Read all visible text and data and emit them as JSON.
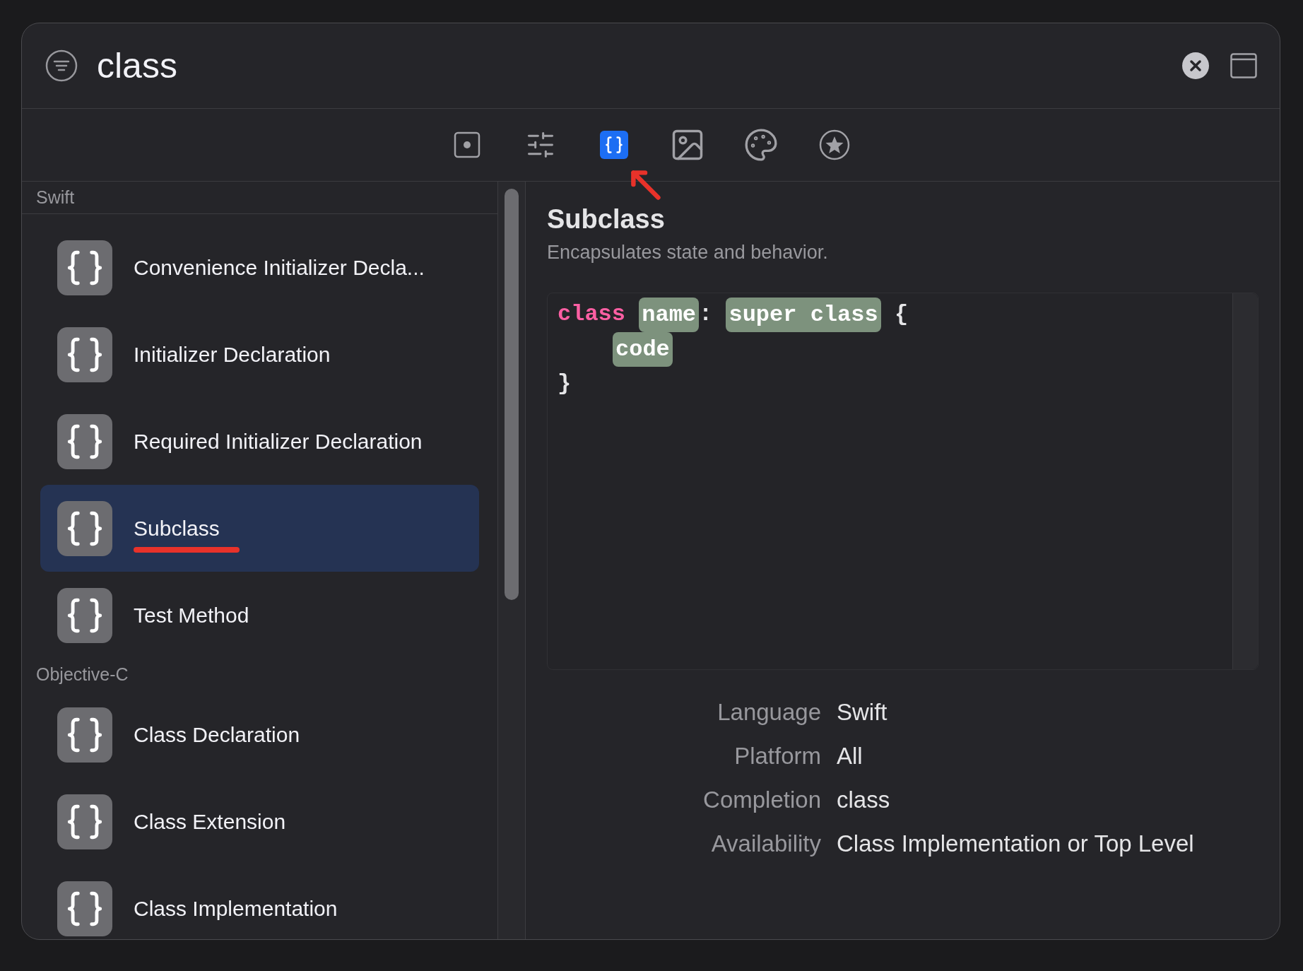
{
  "search": {
    "value": "class"
  },
  "tabs": [
    {
      "kind": "file",
      "selected": false
    },
    {
      "kind": "sliders",
      "selected": false
    },
    {
      "kind": "snippets",
      "selected": true
    },
    {
      "kind": "media",
      "selected": false
    },
    {
      "kind": "colors",
      "selected": false
    },
    {
      "kind": "symbols",
      "selected": false
    }
  ],
  "sections": [
    {
      "title": "Swift",
      "items": [
        {
          "label": "Convenience Initializer Decla...",
          "selected": false
        },
        {
          "label": "Initializer Declaration",
          "selected": false
        },
        {
          "label": "Required Initializer Declaration",
          "selected": false
        },
        {
          "label": "Subclass",
          "selected": true
        },
        {
          "label": "Test Method",
          "selected": false
        }
      ]
    },
    {
      "title": "Objective-C",
      "items": [
        {
          "label": "Class Declaration",
          "selected": false
        },
        {
          "label": "Class Extension",
          "selected": false
        },
        {
          "label": "Class Implementation",
          "selected": false
        }
      ]
    }
  ],
  "detail": {
    "title": "Subclass",
    "description": "Encapsulates state and behavior.",
    "code": [
      {
        "indented": false,
        "tokens": [
          {
            "kind": "keyword",
            "text": "class "
          },
          {
            "kind": "placeholder",
            "text": "name"
          },
          {
            "kind": "plain",
            "text": ": "
          },
          {
            "kind": "placeholder",
            "text": "super class"
          },
          {
            "kind": "plain",
            "text": " {"
          }
        ]
      },
      {
        "indented": true,
        "tokens": [
          {
            "kind": "placeholder",
            "text": "code"
          }
        ]
      },
      {
        "indented": false,
        "tokens": [
          {
            "kind": "plain",
            "text": "}"
          }
        ]
      }
    ],
    "properties": [
      {
        "label": "Language",
        "value": "Swift"
      },
      {
        "label": "Platform",
        "value": "All"
      },
      {
        "label": "Completion",
        "value": "class"
      },
      {
        "label": "Availability",
        "value": "Class Implementation or Top Level"
      }
    ]
  }
}
